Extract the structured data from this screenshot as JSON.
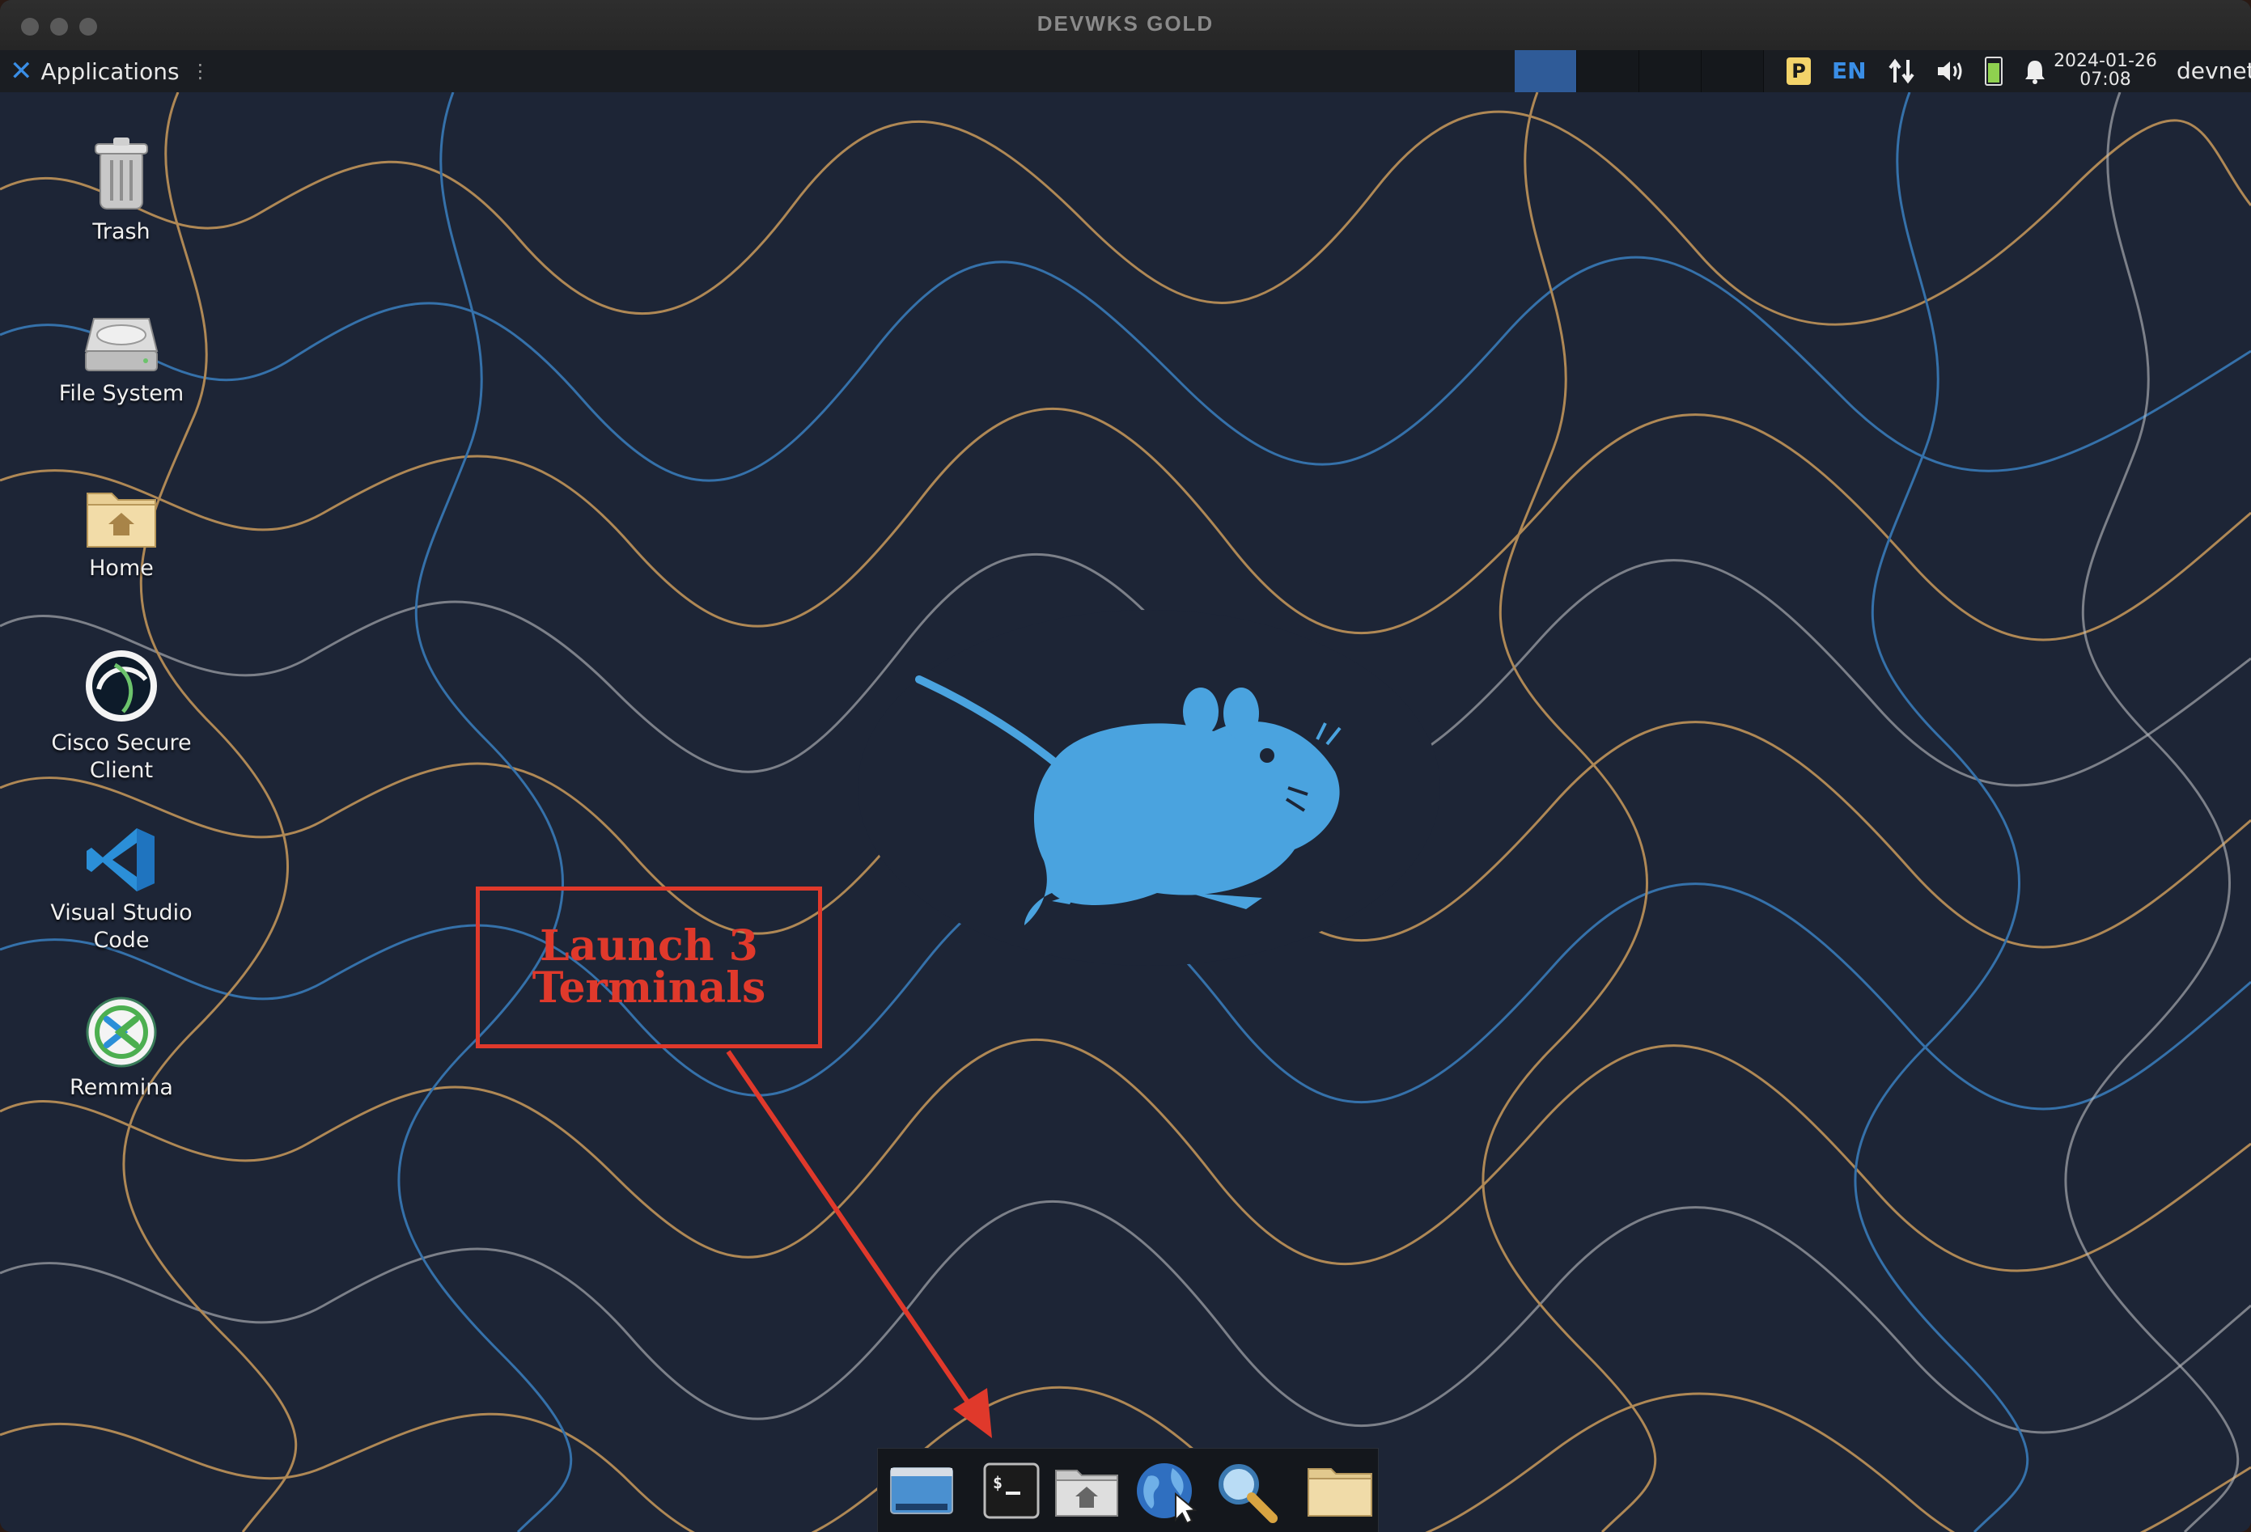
{
  "window": {
    "title": "DEVWKS GOLD"
  },
  "panel": {
    "applications_label": "Applications",
    "language": "EN",
    "clock_date": "2024-01-26",
    "clock_time": "07:08",
    "user": "devnet",
    "workspaces": [
      {
        "active": true
      },
      {
        "active": false
      },
      {
        "active": false
      },
      {
        "active": false
      }
    ],
    "tray_icons": [
      "clipboard-manager-icon",
      "network-updown-icon",
      "volume-icon",
      "battery-icon",
      "notification-bell-icon"
    ]
  },
  "desktop": {
    "icons": [
      {
        "label": "Trash",
        "icon": "trash-icon"
      },
      {
        "label": "File System",
        "icon": "drive-icon"
      },
      {
        "label": "Home",
        "icon": "home-folder-icon"
      },
      {
        "label_line1": "Cisco Secure",
        "label_line2": "Client",
        "icon": "cisco-secure-client-icon"
      },
      {
        "label_line1": "Visual Studio",
        "label_line2": "Code",
        "icon": "vscode-icon"
      },
      {
        "label": "Remmina",
        "icon": "remmina-icon"
      }
    ]
  },
  "annotation": {
    "line1": "Launch 3",
    "line2": "Terminals",
    "color": "#e0392b"
  },
  "dock": {
    "items": [
      "show-desktop-icon",
      "terminal-icon",
      "home-files-icon",
      "web-browser-icon",
      "app-finder-icon",
      "folder-icon"
    ]
  },
  "colors": {
    "accent": "#3a8ee6",
    "wallpaper": "#1d2536",
    "mouse_logo": "#4aa3df"
  }
}
